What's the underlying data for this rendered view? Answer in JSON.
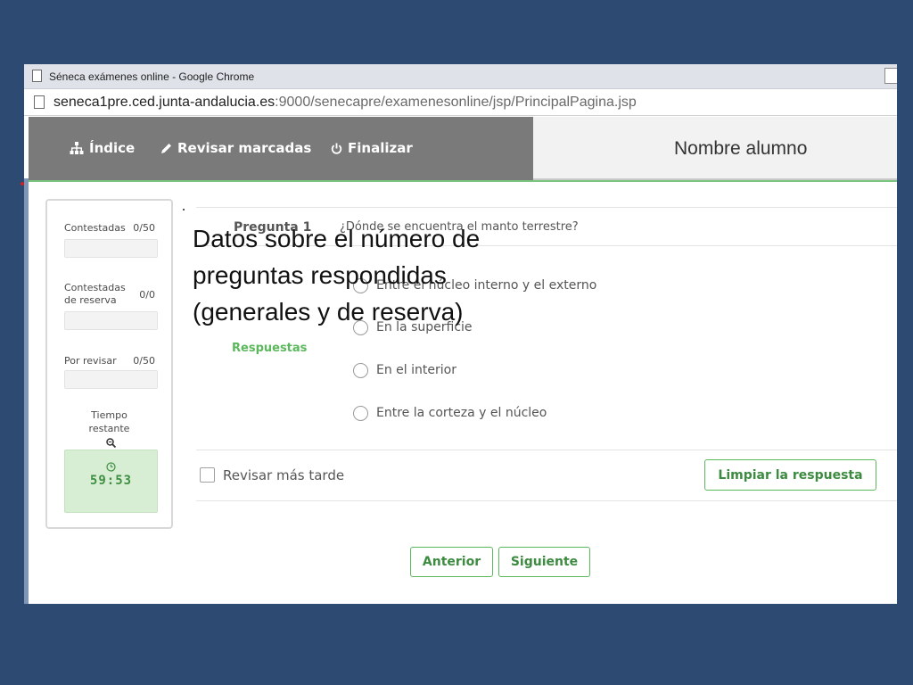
{
  "window": {
    "title": "Séneca exámenes online - Google Chrome",
    "url_host": "seneca1pre.ced.junta-andalucia.es",
    "url_rest": ":9000/senecapre/examenesonline/jsp/PrincipalPagina.jsp"
  },
  "nav": {
    "index_label": "Índice",
    "review_label": "Revisar marcadas",
    "finish_label": "Finalizar"
  },
  "student": {
    "name": "Nombre alumno"
  },
  "side": {
    "answered_label": "Contestadas",
    "answered_count": "0/50",
    "reserve_label_1": "Contestadas",
    "reserve_label_2": "de reserva",
    "reserve_count": "0/0",
    "review_label": "Por revisar",
    "review_count": "0/50",
    "time_label_1": "Tiempo",
    "time_label_2": "restante",
    "timer": "59:53"
  },
  "question": {
    "label": "Pregunta 1",
    "text": "¿Dónde se encuentra el manto terrestre?",
    "answers_label": "Respuestas",
    "options": [
      "Entre el núcleo interno y el externo",
      "En la superficie",
      "En el interior",
      "Entre la corteza y el núcleo"
    ]
  },
  "actions": {
    "review_later_label": "Revisar más tarde",
    "clear_label": "Limpiar la respuesta",
    "previous_label": "Anterior",
    "next_label": "Siguiente"
  },
  "annotation": {
    "line1": "Datos sobre el número de",
    "line2": "preguntas respondidas",
    "line3": "(generales y de reserva)"
  },
  "colors": {
    "background": "#2c4a72",
    "app_bar": "#7a7a7a",
    "accent_green": "#5cb85c",
    "timer_bg": "#d8eed4"
  }
}
